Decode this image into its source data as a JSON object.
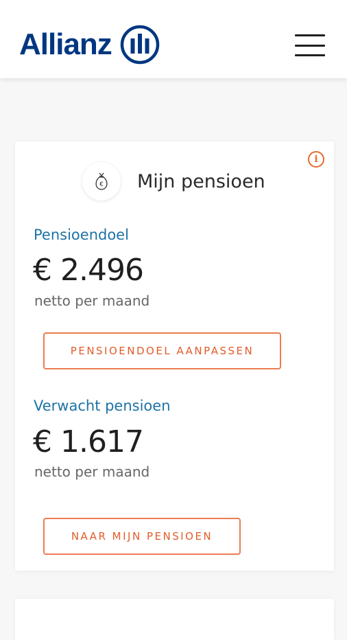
{
  "header": {
    "logo_text": "Allianz",
    "menu_icon": "hamburger-menu-icon"
  },
  "pension_card": {
    "title": "Mijn pensioen",
    "title_icon": "money-bag-euro-icon",
    "info_icon": "info-icon",
    "info_glyph": "i",
    "goal": {
      "label": "Pensioendoel",
      "amount": "€ 2.496",
      "period": "netto per maand",
      "button_label": "PENSIOENDOEL AANPASSEN"
    },
    "expected": {
      "label": "Verwacht pensioen",
      "amount": "€ 1.617",
      "period": "netto per maand",
      "button_label": "NAAR MIJN PENSIOEN"
    }
  },
  "colors": {
    "brand_blue": "#003781",
    "label_blue": "#1e72a6",
    "accent_orange": "#e76b2c"
  }
}
